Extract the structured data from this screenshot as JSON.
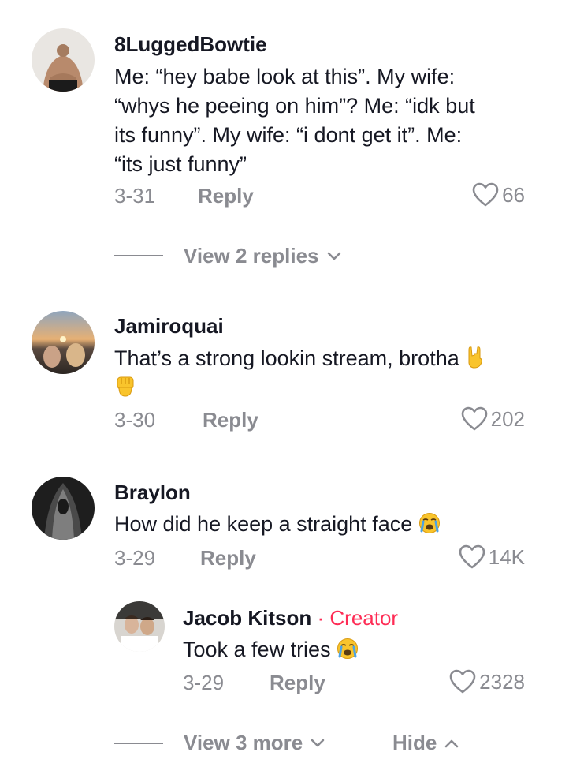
{
  "comments": [
    {
      "username": "8LuggedBowtie",
      "lines": [
        "Me: “hey babe look at this”. My wife:",
        "“whys he peeing on him”? Me: “idk but",
        "its funny”. My wife: “i dont get it”. Me:",
        "“its just funny”"
      ],
      "date": "3-31",
      "reply_label": "Reply",
      "likes": "66",
      "view_replies": "View 2 replies"
    },
    {
      "username": "Jamiroquai",
      "text": "That’s a strong lookin stream, brotha",
      "date": "3-30",
      "reply_label": "Reply",
      "likes": "202"
    },
    {
      "username": "Braylon",
      "text": "How did he keep a straight face",
      "date": "3-29",
      "reply_label": "Reply",
      "likes": "14K",
      "reply": {
        "username": "Jacob Kitson",
        "separator": "·",
        "badge": "Creator",
        "text": "Took a few tries",
        "date": "3-29",
        "reply_label": "Reply",
        "likes": "2328"
      },
      "view_more": "View 3 more",
      "hide_label": "Hide"
    }
  ],
  "colors": {
    "accent": "#fe2c55",
    "muted": "#8a8b91",
    "text": "#161823"
  },
  "icons": [
    "heart-outline-icon",
    "chevron-down-icon",
    "chevron-up-icon",
    "rock-on-emoji",
    "raised-fist-emoji",
    "crying-face-emoji"
  ]
}
